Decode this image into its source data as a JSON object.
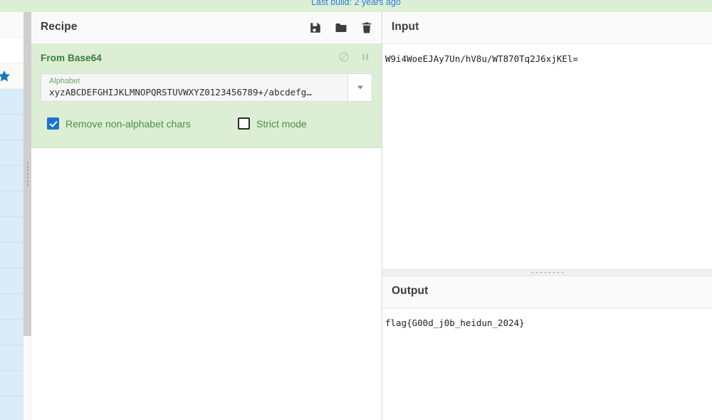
{
  "banner": {
    "text": "Last build: 2 years ago",
    "color": "#2b7de0",
    "background": "#dceed4"
  },
  "operations_list": {
    "name": "operations-list",
    "rows": 16,
    "favourite_icon": "star-icon",
    "selected_background": "#d9ecf7"
  },
  "recipe": {
    "title": "Recipe",
    "icons": [
      {
        "name": "save-recipe-icon",
        "label": "Save recipe"
      },
      {
        "name": "load-recipe-icon",
        "label": "Load recipe"
      },
      {
        "name": "clear-recipe-icon",
        "label": "Clear recipe"
      }
    ],
    "operation": {
      "name": "From Base64",
      "background": "#dceed4",
      "title_color": "#3a7c3a",
      "controls": [
        {
          "name": "disable-operation-icon",
          "label": "Disable operation"
        },
        {
          "name": "set-breakpoint-icon",
          "label": "Set breakpoint"
        }
      ],
      "argument": {
        "label": "Alphabet",
        "value": "xyzABCDEFGHIJKLMNOPQRSTUVWXYZ0123456789+/abcdefg…"
      },
      "checkboxes": [
        {
          "label": "Remove non-alphabet chars",
          "checked": true
        },
        {
          "label": "Strict mode",
          "checked": false
        }
      ]
    }
  },
  "input": {
    "title": "Input",
    "value": "W9i4WoeEJAy7Un/hV8u/WT870Tq2J6xjKEl="
  },
  "output": {
    "title": "Output",
    "value": "flag{G00d_j0b_heidun_2024}"
  }
}
